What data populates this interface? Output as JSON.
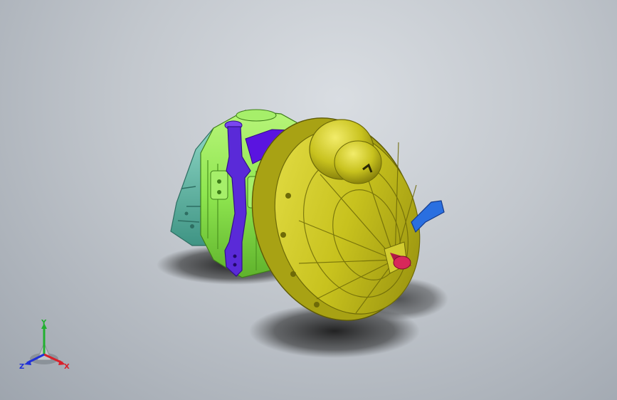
{
  "viewport": {
    "background": {
      "top": "#d9dde2",
      "bottom": "#9ea5ae"
    },
    "model": {
      "colors": {
        "housing_teal": "#5fb6a6",
        "housing_green": "#8fe650",
        "band_purple": "#5a14e0",
        "bracket_purple": "#5a2ad8",
        "bell_yellow": "#c8c21e",
        "lever_blue": "#2a6fe0",
        "shaft_pink": "#d8285a"
      }
    },
    "triad": {
      "x_label": "X",
      "y_label": "Y",
      "z_label": "Z",
      "x_color": "#d8202a",
      "y_color": "#22b030",
      "z_color": "#2030d8"
    }
  }
}
